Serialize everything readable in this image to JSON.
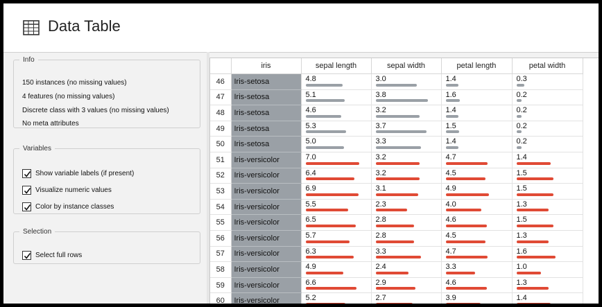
{
  "window": {
    "title": "Data Table",
    "title_icon": "table-icon"
  },
  "info": {
    "legend": "Info",
    "lines": [
      "150 instances (no missing values)",
      "4 features (no missing values)",
      "Discrete class with 3 values (no missing values)",
      "No meta attributes"
    ]
  },
  "variables": {
    "legend": "Variables",
    "options": [
      {
        "label": "Show variable labels (if present)",
        "checked": true
      },
      {
        "label": "Visualize numeric values",
        "checked": true
      },
      {
        "label": "Color by instance classes",
        "checked": true
      }
    ]
  },
  "selection": {
    "legend": "Selection",
    "options": [
      {
        "label": "Select full rows",
        "checked": true
      }
    ]
  },
  "colors": {
    "setosa_bar": "#9aa0a6",
    "versicolor_bar": "#e04a35",
    "class_cell": "#9aa0a6"
  },
  "table": {
    "columns": [
      "iris",
      "sepal length",
      "sepal width",
      "petal length",
      "petal width"
    ],
    "max": [
      7.9,
      4.4,
      6.9,
      2.5
    ],
    "rows": [
      {
        "n": "46",
        "iris": "Iris-setosa",
        "vals": [
          "4.8",
          "3.0",
          "1.4",
          "0.3"
        ]
      },
      {
        "n": "47",
        "iris": "Iris-setosa",
        "vals": [
          "5.1",
          "3.8",
          "1.6",
          "0.2"
        ]
      },
      {
        "n": "48",
        "iris": "Iris-setosa",
        "vals": [
          "4.6",
          "3.2",
          "1.4",
          "0.2"
        ]
      },
      {
        "n": "49",
        "iris": "Iris-setosa",
        "vals": [
          "5.3",
          "3.7",
          "1.5",
          "0.2"
        ]
      },
      {
        "n": "50",
        "iris": "Iris-setosa",
        "vals": [
          "5.0",
          "3.3",
          "1.4",
          "0.2"
        ]
      },
      {
        "n": "51",
        "iris": "Iris-versicolor",
        "vals": [
          "7.0",
          "3.2",
          "4.7",
          "1.4"
        ]
      },
      {
        "n": "52",
        "iris": "Iris-versicolor",
        "vals": [
          "6.4",
          "3.2",
          "4.5",
          "1.5"
        ]
      },
      {
        "n": "53",
        "iris": "Iris-versicolor",
        "vals": [
          "6.9",
          "3.1",
          "4.9",
          "1.5"
        ]
      },
      {
        "n": "54",
        "iris": "Iris-versicolor",
        "vals": [
          "5.5",
          "2.3",
          "4.0",
          "1.3"
        ]
      },
      {
        "n": "55",
        "iris": "Iris-versicolor",
        "vals": [
          "6.5",
          "2.8",
          "4.6",
          "1.5"
        ]
      },
      {
        "n": "56",
        "iris": "Iris-versicolor",
        "vals": [
          "5.7",
          "2.8",
          "4.5",
          "1.3"
        ]
      },
      {
        "n": "57",
        "iris": "Iris-versicolor",
        "vals": [
          "6.3",
          "3.3",
          "4.7",
          "1.6"
        ]
      },
      {
        "n": "58",
        "iris": "Iris-versicolor",
        "vals": [
          "4.9",
          "2.4",
          "3.3",
          "1.0"
        ]
      },
      {
        "n": "59",
        "iris": "Iris-versicolor",
        "vals": [
          "6.6",
          "2.9",
          "4.6",
          "1.3"
        ]
      },
      {
        "n": "60",
        "iris": "Iris-versicolor",
        "vals": [
          "5.2",
          "2.7",
          "3.9",
          "1.4"
        ]
      }
    ]
  }
}
